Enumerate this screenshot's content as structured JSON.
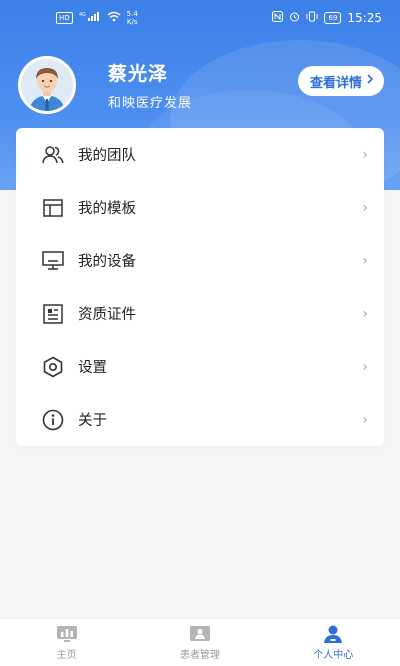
{
  "status_bar": {
    "network_label": "HD",
    "signal_label": "4G",
    "speed_value": "5.4",
    "speed_unit": "K/s",
    "battery_label": "69",
    "time": "15:25"
  },
  "profile": {
    "name": "蔡光泽",
    "organization": "和映医疗发展",
    "detail_button": "查看详情"
  },
  "menu": {
    "items": [
      {
        "label": "我的团队",
        "icon": "team-icon"
      },
      {
        "label": "我的模板",
        "icon": "template-icon"
      },
      {
        "label": "我的设备",
        "icon": "monitor-icon"
      },
      {
        "label": "资质证件",
        "icon": "certificate-icon"
      },
      {
        "label": "设置",
        "icon": "hexagon-settings-icon"
      },
      {
        "label": "关于",
        "icon": "info-icon"
      }
    ],
    "chevron": "›"
  },
  "tab_bar": {
    "tabs": [
      {
        "label": "主页",
        "icon": "home-chart-icon",
        "active": false
      },
      {
        "label": "患者管理",
        "icon": "patient-card-icon",
        "active": false
      },
      {
        "label": "个人中心",
        "icon": "person-icon",
        "active": true
      }
    ]
  },
  "colors": {
    "accent": "#2f6fd8",
    "header_gradient_start": "#3b7fe8",
    "background": "#f4f5f7"
  }
}
